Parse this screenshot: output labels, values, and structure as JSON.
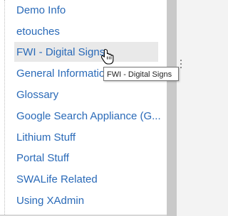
{
  "nav_list": {
    "items": [
      {
        "label": "Demo Info"
      },
      {
        "label": "etouches"
      },
      {
        "label": "FWI - Digital Signs"
      },
      {
        "label": "General Information"
      },
      {
        "label": "Glossary"
      },
      {
        "label": "Google Search Appliance (G..."
      },
      {
        "label": "Lithium Stuff"
      },
      {
        "label": "Portal Stuff"
      },
      {
        "label": "SWALife Related"
      },
      {
        "label": "Using XAdmin"
      }
    ],
    "hovered_index": 2
  },
  "tooltip": {
    "text": "FWI - Digital Signs"
  },
  "colors": {
    "link": "#2a6ab8",
    "hover_bg": "#e9e9e9",
    "scrollbar": "#c9c9c9"
  },
  "icons": {
    "cursor": "hand-pointer-icon"
  }
}
